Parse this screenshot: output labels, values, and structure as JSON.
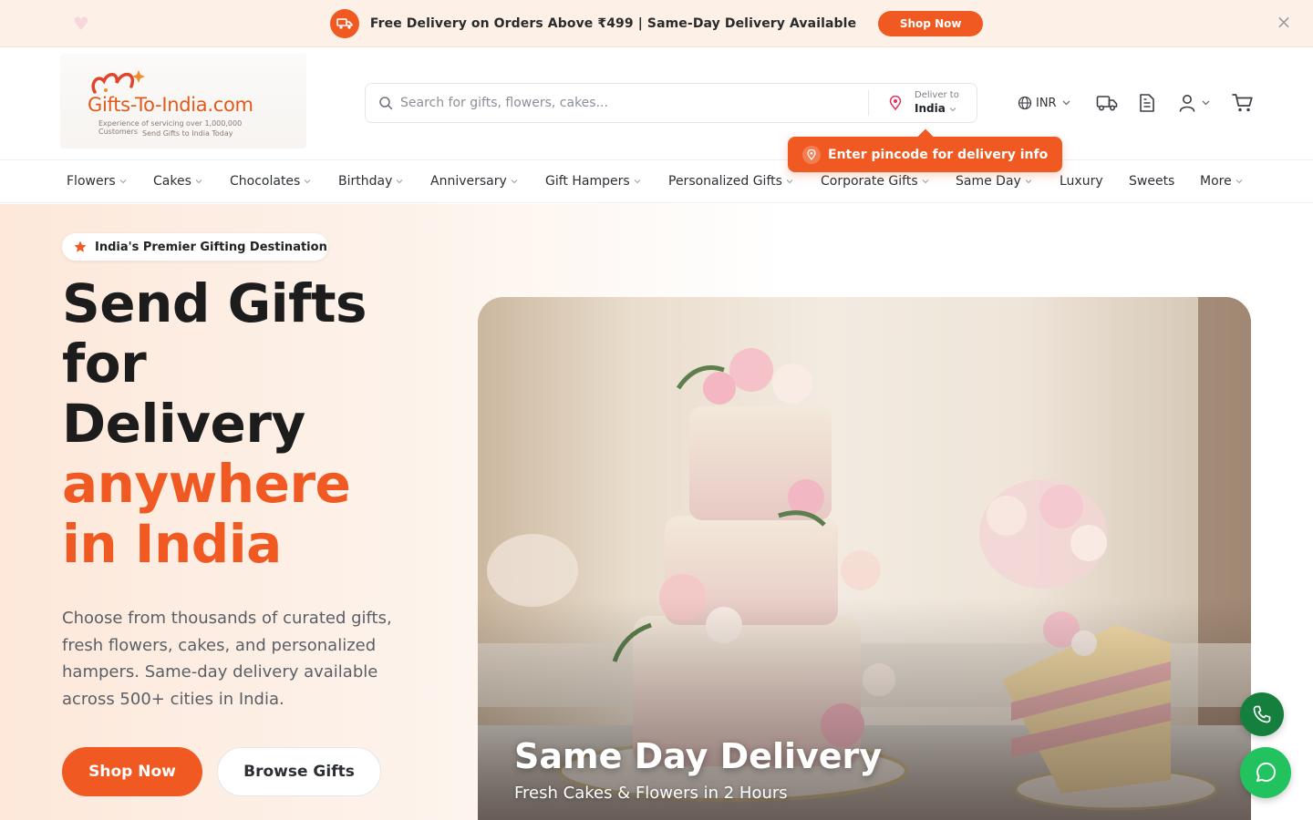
{
  "announcement": {
    "text": "Free Delivery on Orders Above ₹499 | Same-Day Delivery Available",
    "button": "Shop Now",
    "close": "×",
    "icons": {
      "badge": "truck-icon",
      "close": "close-icon",
      "decor": "heart-icon"
    }
  },
  "header": {
    "logo": {
      "brand": "Gifts-To-India.com",
      "tagline1": "Experience of servicing over 1,000,000 Customers",
      "tagline2": "Send Gifts to India Today"
    },
    "search": {
      "placeholder": "Search for gifts, flowers, cakes...",
      "deliver_label": "Deliver to",
      "deliver_value": "India"
    },
    "currency": "INR",
    "icons": [
      "globe-icon",
      "truck-icon",
      "orders-icon",
      "user-icon",
      "cart-icon"
    ]
  },
  "pincode_tip": "Enter pincode for delivery info",
  "nav": [
    {
      "label": "Flowers",
      "dropdown": true
    },
    {
      "label": "Cakes",
      "dropdown": true
    },
    {
      "label": "Chocolates",
      "dropdown": true
    },
    {
      "label": "Birthday",
      "dropdown": true
    },
    {
      "label": "Anniversary",
      "dropdown": true
    },
    {
      "label": "Gift Hampers",
      "dropdown": true
    },
    {
      "label": "Personalized Gifts",
      "dropdown": true
    },
    {
      "label": "Corporate Gifts",
      "dropdown": true
    },
    {
      "label": "Same Day",
      "dropdown": true
    },
    {
      "label": "Luxury",
      "dropdown": false
    },
    {
      "label": "Sweets",
      "dropdown": false
    },
    {
      "label": "More",
      "dropdown": true
    }
  ],
  "hero": {
    "badge": "India's Premier Gifting Destination",
    "headline": [
      "Send Gifts",
      "for",
      "Delivery"
    ],
    "headline_accent": [
      "anywhere",
      "in India"
    ],
    "description": "Choose from thousands of curated gifts, fresh flowers, cakes, and personalized hampers. Same-day delivery available across 500+ cities in India.",
    "primary_button": "Shop Now",
    "secondary_button": "Browse Gifts",
    "image": {
      "title": "Same Day Delivery",
      "subtitle": "Fresh Cakes & Flowers in 2 Hours"
    }
  },
  "floating": {
    "call": "phone-icon",
    "chat": "whatsapp-icon"
  },
  "colors": {
    "accent": "#f05a22",
    "call": "#15803d",
    "whatsapp": "#22c35e"
  }
}
